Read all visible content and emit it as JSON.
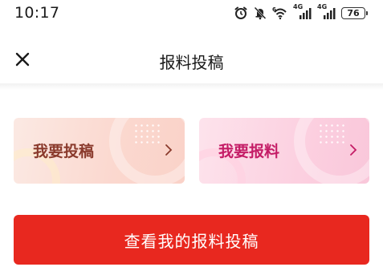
{
  "status_bar": {
    "time": "10:17",
    "network_1": "4G",
    "network_2": "4G",
    "battery": "76",
    "icons": [
      "alarm-icon",
      "mute-icon",
      "wifi-icon",
      "signal-icon",
      "signal-icon",
      "battery-icon"
    ]
  },
  "header": {
    "title": "报料投稿",
    "close_icon": "close-icon"
  },
  "cards": [
    {
      "label": "我要投稿",
      "color": "#8a3a2c"
    },
    {
      "label": "我要报料",
      "color": "#c41c66"
    }
  ],
  "action": {
    "label": "查看我的报料投稿",
    "color": "#e8281f"
  }
}
